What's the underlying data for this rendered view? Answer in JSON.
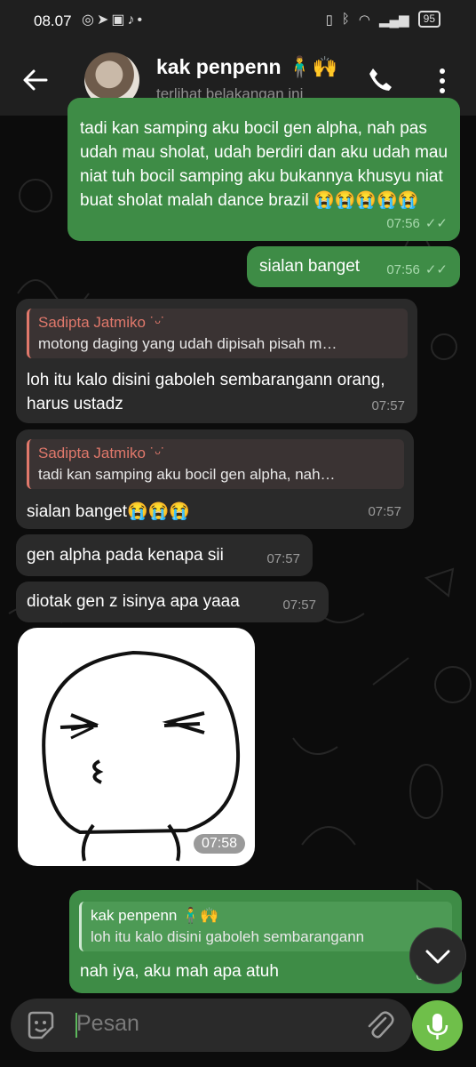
{
  "status_bar": {
    "time": "08.07",
    "battery": "95"
  },
  "header": {
    "contact_name": "kak penpenn 🧍‍♂️🙌",
    "last_seen": "terlihat belakangan ini"
  },
  "messages": [
    {
      "id": "m1",
      "direction": "out",
      "text": "tadi kan samping aku bocil gen alpha, nah pas udah mau sholat, udah berdiri dan aku udah mau niat tuh bocil samping aku bukannya khusyu niat buat sholat malah dance brazil 😭😭😭😭😭",
      "time": "07:56",
      "ticks": "✓✓"
    },
    {
      "id": "m2",
      "direction": "out",
      "text": "sialan banget",
      "time": "07:56",
      "ticks": "✓✓"
    },
    {
      "id": "m3",
      "direction": "in",
      "reply_name": "Sadipta Jatmiko ˙ᵕ˙",
      "reply_text": "motong daging yang udah dipisah pisah m…",
      "text": "loh itu kalo disini gaboleh sembarangann orang, harus ustadz",
      "time": "07:57"
    },
    {
      "id": "m4",
      "direction": "in",
      "reply_name": "Sadipta Jatmiko ˙ᵕ˙",
      "reply_text": "tadi kan samping aku bocil gen alpha, nah…",
      "text": "sialan banget😭😭😭",
      "time": "07:57"
    },
    {
      "id": "m5",
      "direction": "in",
      "text": "gen alpha pada kenapa sii",
      "time": "07:57"
    },
    {
      "id": "m6",
      "direction": "in",
      "text": "diotak gen z isinya apa yaaa",
      "time": "07:57"
    },
    {
      "id": "m7",
      "direction": "in",
      "type": "sticker",
      "time": "07:58"
    },
    {
      "id": "m8",
      "direction": "out",
      "reply_name": "kak penpenn 🧍‍♂️🙌",
      "reply_text": "loh itu kalo disini gaboleh sembarangann",
      "text": "nah iya, aku mah apa atuh",
      "time": "07:58"
    }
  ],
  "input": {
    "placeholder": "Pesan"
  },
  "colors": {
    "outgoing_bubble": "#3e8c46",
    "incoming_bubble": "#2a2a2a",
    "reply_accent": "#e0786b",
    "mic_button": "#6fbf4a"
  }
}
